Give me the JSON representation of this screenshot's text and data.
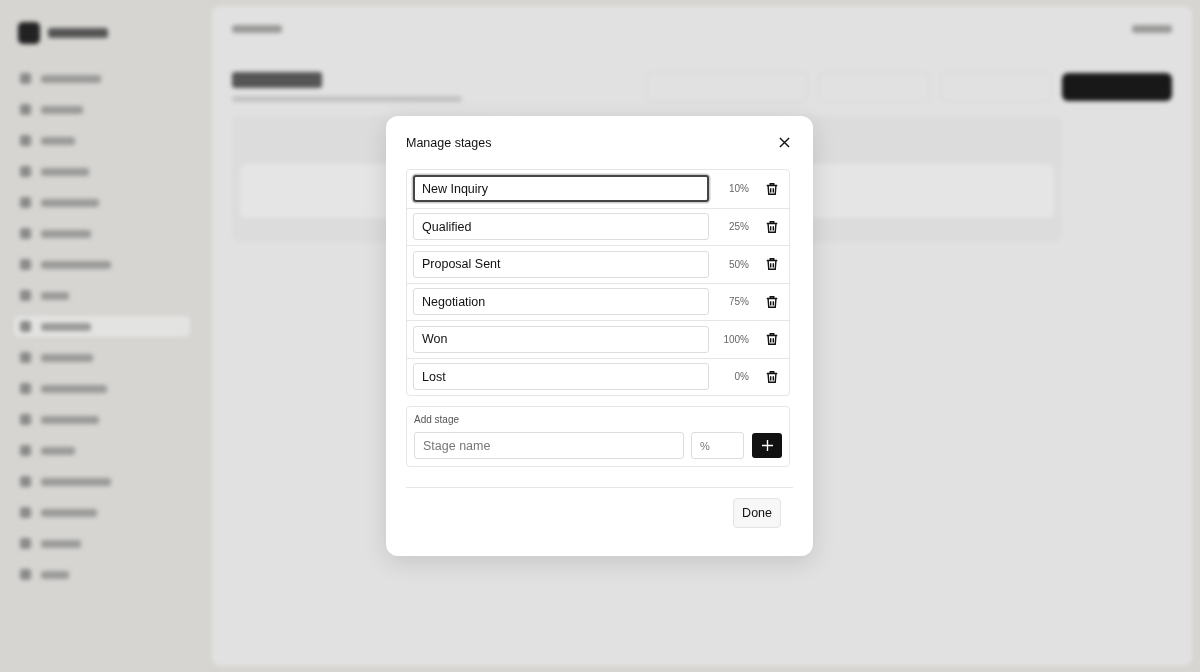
{
  "dialog": {
    "title": "Manage stages",
    "stages": [
      {
        "name": "New Inquiry",
        "percent": "10%",
        "focused": true
      },
      {
        "name": "Qualified",
        "percent": "25%",
        "focused": false
      },
      {
        "name": "Proposal Sent",
        "percent": "50%",
        "focused": false
      },
      {
        "name": "Negotiation",
        "percent": "75%",
        "focused": false
      },
      {
        "name": "Won",
        "percent": "100%",
        "focused": false
      },
      {
        "name": "Lost",
        "percent": "0%",
        "focused": false
      }
    ],
    "add_stage": {
      "label": "Add stage",
      "name_placeholder": "Stage name",
      "percent_placeholder": "%"
    },
    "done": "Done"
  }
}
